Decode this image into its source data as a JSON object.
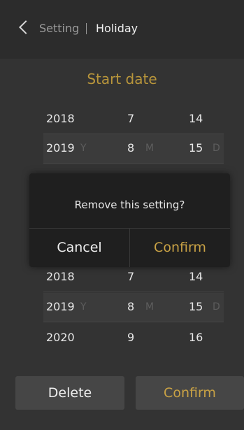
{
  "header": {
    "back_icon": "chevron-left-icon",
    "parent": "Setting",
    "current": "Holiday"
  },
  "start": {
    "title": "Start date",
    "rows": [
      {
        "year": "2018",
        "month": "7",
        "day": "14"
      },
      {
        "year": "2019",
        "month": "8",
        "day": "15",
        "year_unit": "Y",
        "month_unit": "M",
        "day_unit": "D"
      }
    ]
  },
  "end": {
    "rows": [
      {
        "year": "2018",
        "month": "7",
        "day": "14"
      },
      {
        "year": "2019",
        "month": "8",
        "day": "15",
        "year_unit": "Y",
        "month_unit": "M",
        "day_unit": "D"
      },
      {
        "year": "2020",
        "month": "9",
        "day": "16"
      }
    ]
  },
  "dialog": {
    "message": "Remove this setting?",
    "cancel_label": "Cancel",
    "confirm_label": "Confirm"
  },
  "footer": {
    "delete_label": "Delete",
    "confirm_label": "Confirm"
  },
  "colors": {
    "accent": "#c9a245",
    "background": "#3a3a3a",
    "dialog": "#1f1f1f"
  }
}
